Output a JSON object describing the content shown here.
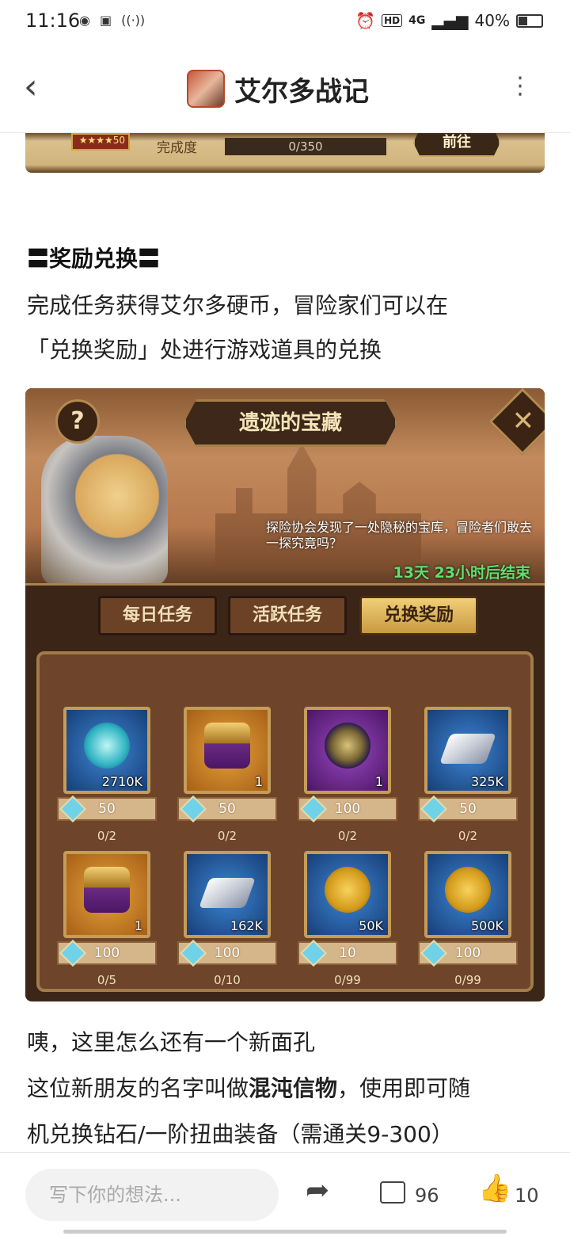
{
  "status": {
    "time": "11:16",
    "network": "4G",
    "hd": "HD",
    "battery": "40%"
  },
  "header": {
    "title": "艾尔多战记"
  },
  "top_image": {
    "stars": "50",
    "label": "完成度",
    "progress": "0/350",
    "button": "前往"
  },
  "article": {
    "section_title": "〓奖励兑换〓",
    "line1": "完成任务获得艾尔多硬币，冒险家们可以在",
    "line2": "「兑换奖励」处进行游戏道具的兑换",
    "line3": "咦，这里怎么还有一个新面孔",
    "line4_a": "这位新朋友的名字叫做",
    "line4_b": "混沌信物",
    "line4_c": "，使用即可随",
    "line5": "机兑换钻石/一阶扭曲装备（需通关9-300）"
  },
  "game": {
    "help": "?",
    "banner": "遗迹的宝藏",
    "description": "探险协会发现了一处隐秘的宝库，冒险者们敢去一探究竟吗？",
    "countdown": "13天 23小时后结束",
    "tabs": [
      "每日任务",
      "活跃任务",
      "兑换奖励"
    ],
    "items": [
      {
        "qty": "2710K",
        "cost": "50",
        "limit": "0/2"
      },
      {
        "qty": "1",
        "cost": "50",
        "limit": "0/2"
      },
      {
        "qty": "1",
        "cost": "100",
        "limit": "0/2"
      },
      {
        "qty": "325K",
        "cost": "50",
        "limit": "0/2"
      },
      {
        "qty": "1",
        "cost": "100",
        "limit": "0/5"
      },
      {
        "qty": "162K",
        "cost": "100",
        "limit": "0/10"
      },
      {
        "qty": "50K",
        "cost": "10",
        "limit": "0/99"
      },
      {
        "qty": "500K",
        "cost": "100",
        "limit": "0/99"
      }
    ]
  },
  "bottom": {
    "placeholder": "写下你的想法...",
    "comments": "96",
    "likes": "10"
  }
}
